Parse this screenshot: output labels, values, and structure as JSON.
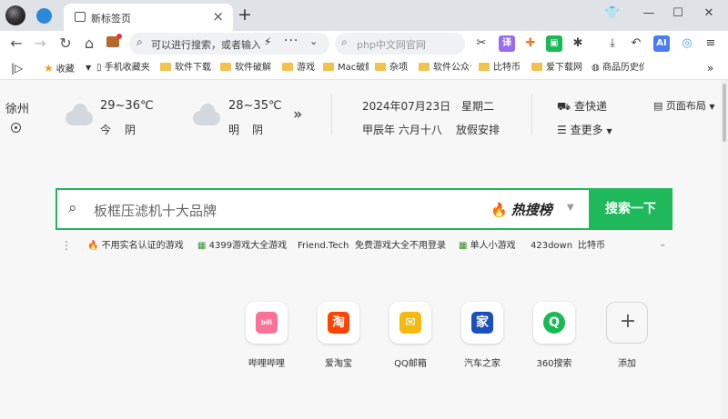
{
  "tab": {
    "title": "新标签页"
  },
  "window": {
    "skin_icon": "👕",
    "minimize": "—",
    "maximize": "☐",
    "close": "✕"
  },
  "toolbar": {
    "omnibox_text": "可以进行搜索，或者输入网址",
    "search_placeholder": "php中文网官网",
    "ai_label": "AI"
  },
  "bookmarks": [
    "收藏",
    "手机收藏夹",
    "软件下载",
    "软件破解",
    "游戏",
    "Mac破解",
    "杂项",
    "软件公众号",
    "比特币",
    "爱下载网",
    "商品历史价格"
  ],
  "weather": {
    "city": "徐州",
    "today": {
      "temp": "29~36℃",
      "day": "今",
      "cond": "阴"
    },
    "tomorrow": {
      "temp": "28~35℃",
      "day": "明",
      "cond": "阴"
    }
  },
  "calendar": {
    "date": "2024年07月23日",
    "weekday": "星期二",
    "lunar": "甲辰年 六月十八",
    "note": "放假安排"
  },
  "quick": {
    "express": "查快递",
    "more": "查更多",
    "layout": "页面布局"
  },
  "search": {
    "query": "板框压滤机十大品牌",
    "hot_label": "热搜榜",
    "button": "搜索一下"
  },
  "hot_links": [
    "不用实名认证的游戏",
    "4399游戏大全游戏",
    "Friend.Tech",
    "免费游戏大全不用登录",
    "单人小游戏",
    "423down",
    "比特币"
  ],
  "tiles": [
    {
      "label": "哔哩哔哩",
      "glyph": "bili",
      "color": "#fb7299"
    },
    {
      "label": "爱淘宝",
      "glyph": "淘",
      "color": "#ff4400"
    },
    {
      "label": "QQ邮箱",
      "glyph": "✉",
      "color": "#f6b90f"
    },
    {
      "label": "汽车之家",
      "glyph": "家",
      "color": "#1a4fbd"
    },
    {
      "label": "360搜索",
      "glyph": "Q",
      "color": "#19b955"
    },
    {
      "label": "添加",
      "glyph": "+",
      "color": "#ffffff"
    }
  ]
}
